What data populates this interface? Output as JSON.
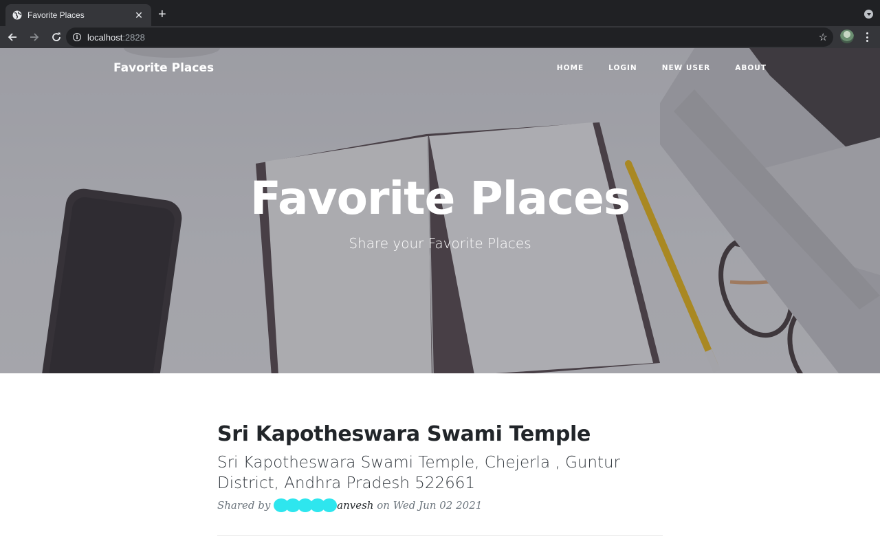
{
  "browser": {
    "tab_title": "Favorite Places",
    "tab_close": "✕",
    "new_tab": "+",
    "url_host": "localhost",
    "url_port": ":2828",
    "icons": [
      "globe-icon",
      "close-icon",
      "plus-icon",
      "back-arrow-icon",
      "forward-arrow-icon",
      "reload-icon",
      "info-icon",
      "star-icon",
      "avatar",
      "kebab-menu-icon"
    ]
  },
  "site": {
    "brand": "Favorite Places",
    "nav": [
      {
        "label": "HOME"
      },
      {
        "label": "LOGIN"
      },
      {
        "label": "NEW USER"
      },
      {
        "label": "ABOUT"
      }
    ]
  },
  "hero": {
    "title": "Favorite Places",
    "subtitle": "Share your Favorite Places"
  },
  "post": {
    "title": "Sri Kapotheswara Swami Temple",
    "subtitle": "Sri Kapotheswara Swami Temple, Chejerla , Guntur District, Andhra Pradesh 522661",
    "meta_prefix": "Shared by ",
    "author_visible": "anvesh",
    "meta_on": " on ",
    "date": "Wed Jun 02 2021"
  },
  "colors": {
    "chrome_dark": "#202124",
    "chrome_tab": "#35363a",
    "text_dark": "#212529",
    "meta_gray": "#6c757d",
    "redaction": "#2ee6ee"
  }
}
